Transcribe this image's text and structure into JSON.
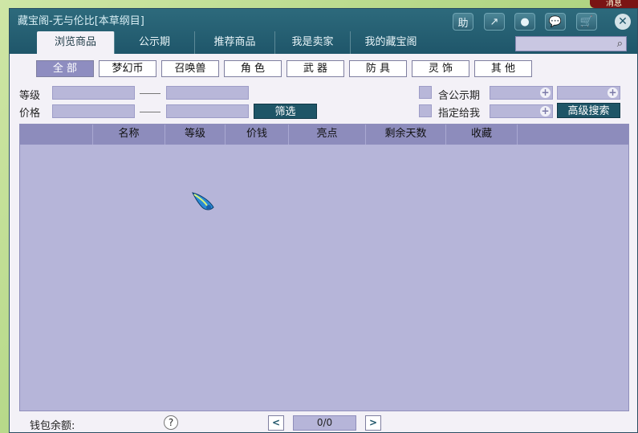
{
  "window": {
    "title": "藏宝阁-无与伦比[本草纲目]"
  },
  "topright_tag": "消息",
  "toolbar": [
    {
      "icon": "help-icon",
      "label": "助"
    },
    {
      "icon": "share-icon",
      "label": "↗"
    },
    {
      "icon": "stop-icon",
      "label": "●"
    },
    {
      "icon": "chat-icon",
      "label": "💬"
    },
    {
      "icon": "cart-icon",
      "label": "🛒"
    }
  ],
  "tabs": [
    {
      "label": "浏览商品",
      "active": true
    },
    {
      "label": "公示期",
      "active": false
    },
    {
      "label": "推荐商品",
      "active": false
    },
    {
      "label": "我是卖家",
      "active": false
    },
    {
      "label": "我的藏宝阁",
      "active": false
    }
  ],
  "search": {
    "placeholder": ""
  },
  "categories": [
    {
      "label": "全 部",
      "active": true
    },
    {
      "label": "梦幻币",
      "active": false
    },
    {
      "label": "召唤兽",
      "active": false
    },
    {
      "label": "角 色",
      "active": false
    },
    {
      "label": "武 器",
      "active": false
    },
    {
      "label": "防 具",
      "active": false
    },
    {
      "label": "灵 饰",
      "active": false
    },
    {
      "label": "其 他",
      "active": false
    }
  ],
  "filters": {
    "level_label": "等级",
    "price_label": "价格",
    "filter_button": "筛选",
    "public_period_label": "含公示期",
    "assigned_label": "指定给我",
    "advanced_search": "高级搜索"
  },
  "table": {
    "columns": [
      "",
      "名称",
      "等级",
      "价钱",
      "亮点",
      "剩余天数",
      "收藏",
      ""
    ]
  },
  "footer": {
    "wallet_label": "钱包余额:",
    "help": "?",
    "page": "0/0",
    "prev": "<",
    "next": ">"
  },
  "colors": {
    "titlebar": "#1f566a",
    "accent": "#8e8dc0",
    "table_bg": "#b6b5d9"
  }
}
